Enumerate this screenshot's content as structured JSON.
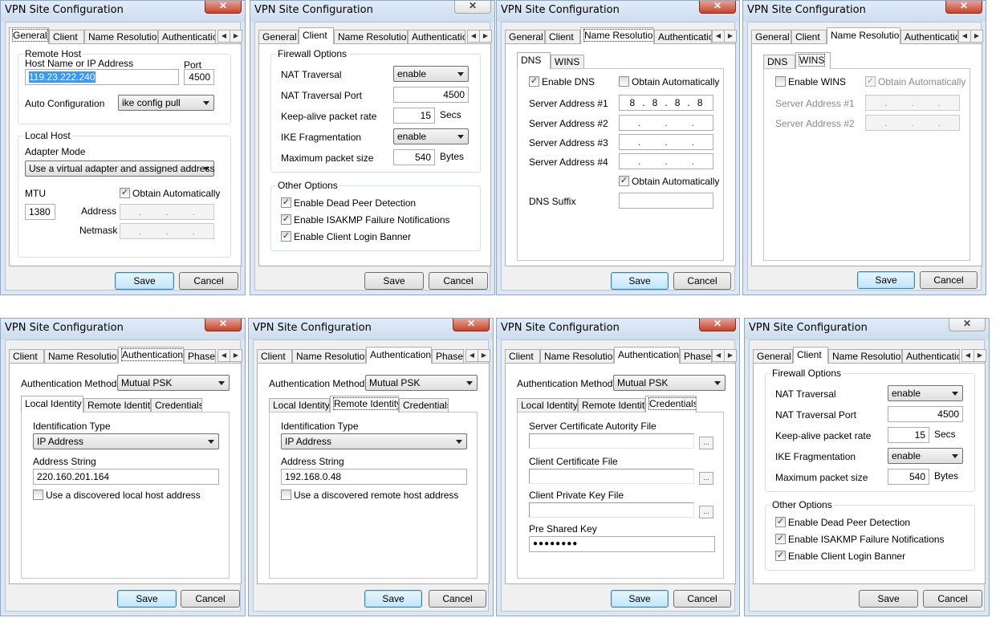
{
  "window_title": "VPN Site Configuration",
  "buttons": {
    "save": "Save",
    "cancel": "Cancel"
  },
  "tabs": {
    "general": "General",
    "client": "Client",
    "name_resolution": "Name Resolution",
    "authentication": "Authenticatic",
    "authentication_full": "Authentication",
    "phase": "Phase"
  },
  "general": {
    "remote_host": "Remote Host",
    "host_label": "Host Name or IP Address",
    "host_value": "119.23.222.240",
    "port_label": "Port",
    "port_value": "4500",
    "auto_config_label": "Auto Configuration",
    "auto_config_value": "ike config pull",
    "local_host": "Local Host",
    "adapter_label": "Adapter Mode",
    "adapter_value": "Use a virtual adapter and assigned address",
    "mtu_label": "MTU",
    "mtu_value": "1380",
    "obtain_auto": "Obtain Automatically",
    "obtain_auto_checked": true,
    "address_label": "Address",
    "netmask_label": "Netmask"
  },
  "client": {
    "firewall_options": "Firewall Options",
    "nat_traversal": "NAT Traversal",
    "nat_traversal_value": "enable",
    "nat_port": "NAT Traversal Port",
    "nat_port_value": "4500",
    "keepalive": "Keep-alive packet rate",
    "keepalive_value": "15",
    "keepalive_unit": "Secs",
    "ike_frag": "IKE Fragmentation",
    "ike_frag_value": "enable",
    "max_packet": "Maximum packet size",
    "max_packet_value": "540",
    "max_packet_unit": "Bytes",
    "other_options": "Other Options",
    "dpd": "Enable Dead Peer Detection",
    "isakmp": "Enable ISAKMP Failure Notifications",
    "banner": "Enable Client Login Banner"
  },
  "name_resolution": {
    "dns_tab": "DNS",
    "wins_tab": "WINS",
    "enable_dns": "Enable DNS",
    "obtain_auto": "Obtain Automatically",
    "server1": "Server Address #1",
    "server2": "Server Address #2",
    "server3": "Server Address #3",
    "server4": "Server Address #4",
    "server1_octets": [
      "8",
      "8",
      "8",
      "8"
    ],
    "obtain_auto2": "Obtain Automatically",
    "dns_suffix": "DNS Suffix",
    "enable_wins": "Enable WINS"
  },
  "authentication": {
    "method_label": "Authentication Method",
    "method_value": "Mutual PSK",
    "local_identity_tab": "Local Identity",
    "remote_identity_tab": "Remote Identity",
    "credentials_tab": "Credentials",
    "id_type_label": "Identification Type",
    "id_type_value": "IP Address",
    "address_string_label": "Address String",
    "local_address": "220.160.201.164",
    "remote_address": "192.168.0.48",
    "use_discovered_local": "Use a discovered local host address",
    "use_discovered_remote": "Use a discovered remote host address",
    "server_cert": "Server Certificate Autority File",
    "client_cert": "Client Certificate File",
    "client_key": "Client Private Key File",
    "psk_label": "Pre Shared Key",
    "psk_value": "●●●●●●●●",
    "browse": "..."
  },
  "icons": {
    "close": "close-icon",
    "tab_left": "chevron-left-icon",
    "tab_right": "chevron-right-icon",
    "check": "check-icon",
    "dropdown": "chevron-down-icon"
  }
}
